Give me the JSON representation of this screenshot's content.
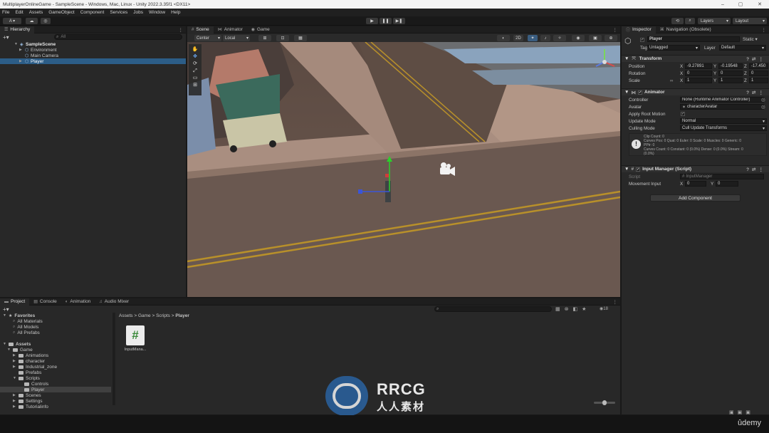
{
  "titlebar": {
    "text": "MultiplayerOnlineGame - SampleScene - Windows, Mac, Linux - Unity 2022.3.35f1 <DX11>",
    "min": "–",
    "max": "▢",
    "close": "✕"
  },
  "menu": [
    "File",
    "Edit",
    "Assets",
    "GameObject",
    "Component",
    "Services",
    "Jobs",
    "Window",
    "Help"
  ],
  "toolbar": {
    "account": "A ▾",
    "play": "▶",
    "pause": "❚❚",
    "step": "▶❚",
    "layers": "Layers",
    "layout": "Layout"
  },
  "hierarchy": {
    "tab": "Hierarchy",
    "search_placeholder": "All",
    "scene": "SampleScene",
    "items": [
      "Environment",
      "Main Camera",
      "Player"
    ]
  },
  "scene_tabs": [
    "Scene",
    "Animator",
    "Game"
  ],
  "scene_toolbar": {
    "pivot": "Center",
    "space": "Local",
    "mode2d": "2D"
  },
  "inspector": {
    "tabs": [
      "Inspector",
      "Navigation (Obsolete)"
    ],
    "object_name": "Player",
    "static_label": "Static",
    "tag_label": "Tag",
    "tag_value": "Untagged",
    "layer_label": "Layer",
    "layer_value": "Default",
    "transform": {
      "title": "Transform",
      "position_label": "Position",
      "position": [
        "-9.27891",
        "-0.19548",
        "-17.450"
      ],
      "rotation_label": "Rotation",
      "rotation": [
        "0",
        "0",
        "0"
      ],
      "scale_label": "Scale",
      "scale": [
        "1",
        "1",
        "1"
      ],
      "axes": [
        "X",
        "Y",
        "Z"
      ]
    },
    "animator": {
      "title": "Animator",
      "controller_label": "Controller",
      "controller_value": "None (Runtime Animator Controller)",
      "avatar_label": "Avatar",
      "avatar_value": "characterAvatar",
      "root_motion_label": "Apply Root Motion",
      "update_mode_label": "Update Mode",
      "update_mode_value": "Normal",
      "culling_mode_label": "Culling Mode",
      "culling_mode_value": "Cull Update Transforms",
      "info": [
        "Clip Count: 0",
        "Curves Pos: 0 Quat: 0 Euler: 0 Scale: 0 Muscles: 0 Generic: 0",
        "PPtr: 0",
        "Curves Count: 0 Constant: 0 (0.0%) Dense: 0 (0.0%) Stream: 0",
        "(0.0%)"
      ]
    },
    "input_manager": {
      "title": "Input Manager (Script)",
      "script_label": "Script",
      "script_value": "InputManager",
      "movement_label": "Movement Input",
      "x_label": "X",
      "x": "0",
      "y_label": "Y",
      "y": "0"
    },
    "add_component": "Add Component"
  },
  "bottom_tabs": [
    "Project",
    "Console",
    "Animation",
    "Audio Mixer"
  ],
  "project": {
    "favorites_label": "Favorites",
    "favorites": [
      "All Materials",
      "All Models",
      "All Prefabs"
    ],
    "assets_label": "Assets",
    "game_label": "Game",
    "game_children": [
      "Animations",
      "character",
      "Industrial_zone",
      "Prefabs",
      "Scripts"
    ],
    "scripts_children": [
      "Controls",
      "Player"
    ],
    "other": [
      "Scenes",
      "Settings",
      "Tutorialinfo"
    ],
    "breadcrumb": [
      "Assets",
      "Game",
      "Scripts",
      "Player"
    ],
    "file_name": "InputMana...",
    "file_icon": "#",
    "hidden_count": "18"
  },
  "watermark": {
    "title": "RRCG",
    "subtitle": "人人素材"
  },
  "udemy": "ûdemy"
}
